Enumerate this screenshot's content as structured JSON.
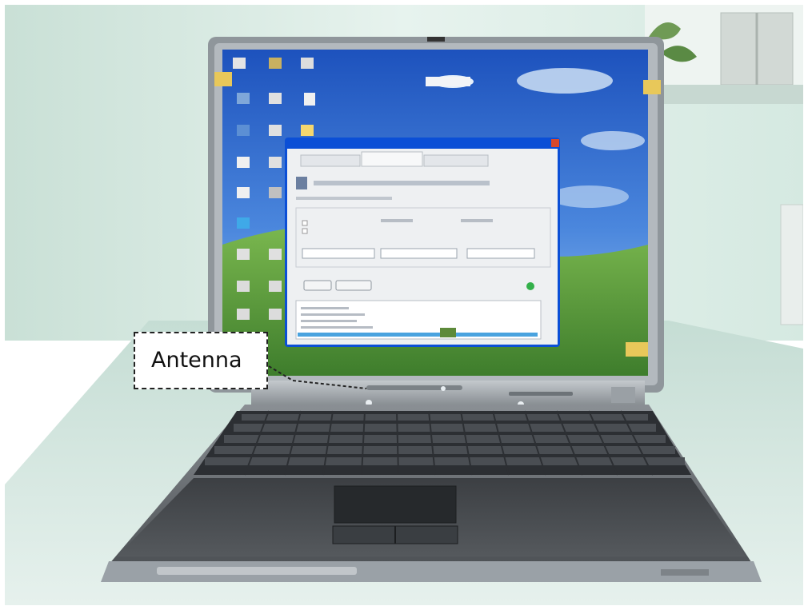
{
  "callout": {
    "label": "Antenna"
  },
  "colors": {
    "wall": "#d9ece3",
    "desk": "#d3e7df",
    "laptop_body": "#6f7377",
    "bezel": "#9ea5ab",
    "sky": "#2a63c8",
    "hill": "#4f9a3a",
    "dialog": "#eef0f2",
    "tape": "#e8c85a"
  }
}
